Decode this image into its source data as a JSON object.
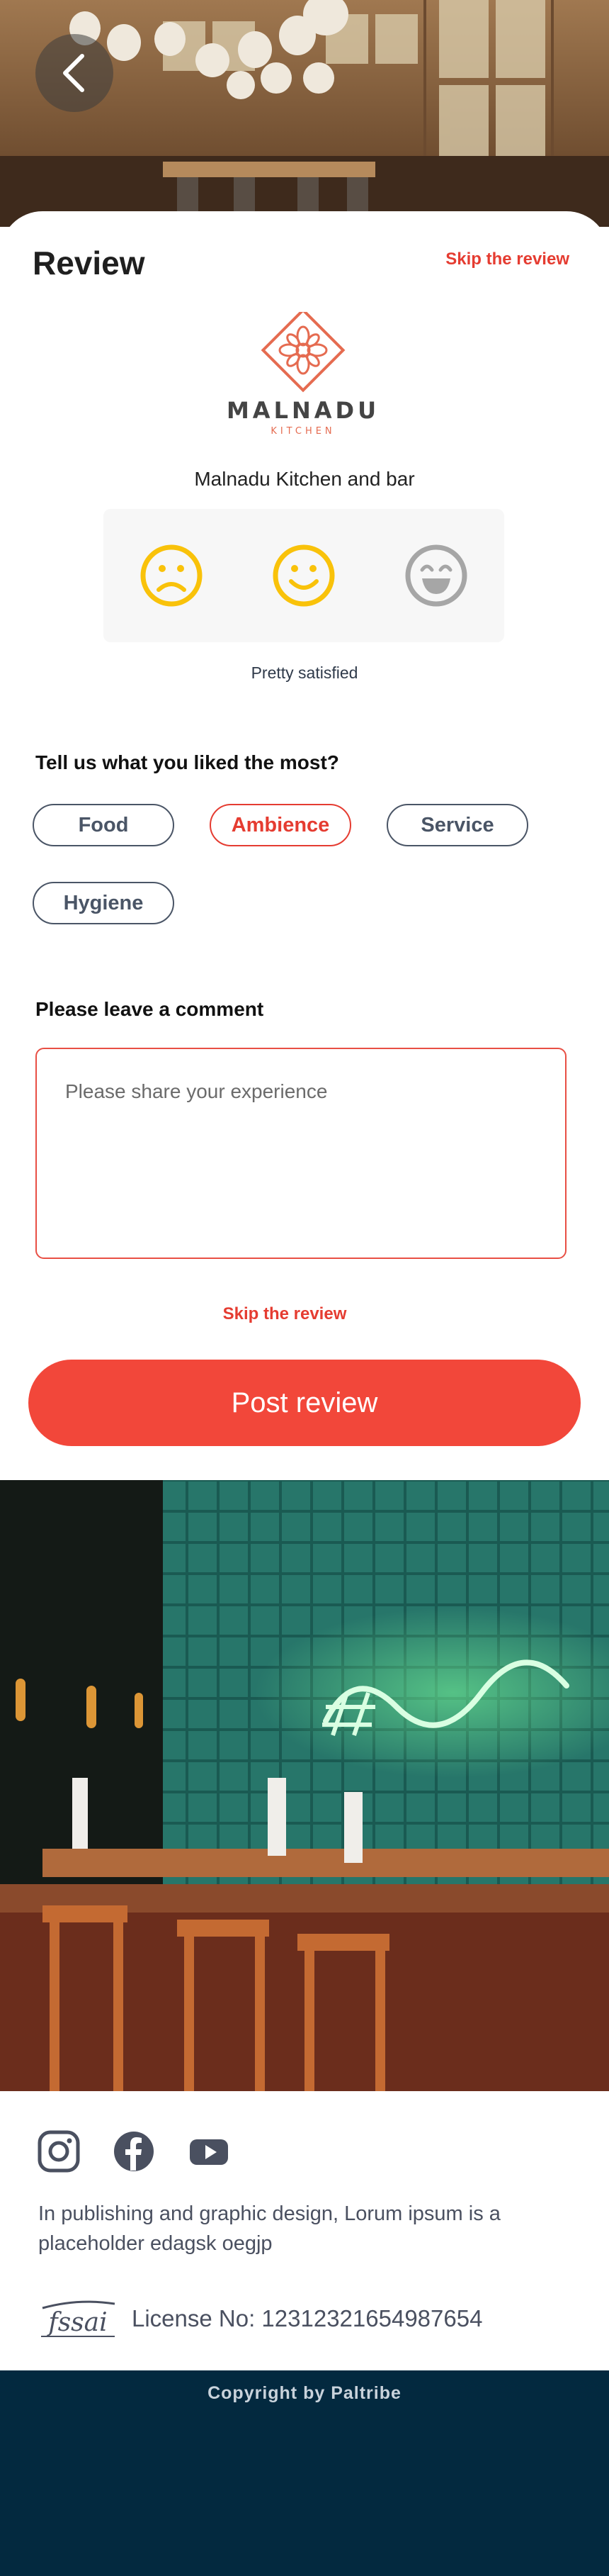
{
  "header": {
    "title": "Review",
    "skip_label": "Skip the review"
  },
  "restaurant": {
    "logo_text": "MALNADU",
    "logo_subtext": "KITCHEN",
    "name": "Malnadu Kitchen and bar"
  },
  "rating": {
    "options": [
      "frowning-face-icon",
      "smiling-face-icon",
      "grinning-face-icon"
    ],
    "selected_caption": "Pretty satisfied"
  },
  "likes": {
    "title": "Tell us what you liked the most?",
    "chips": [
      {
        "label": "Food",
        "selected": false
      },
      {
        "label": "Ambience",
        "selected": true
      },
      {
        "label": "Service",
        "selected": false
      },
      {
        "label": "Hygiene",
        "selected": false
      }
    ]
  },
  "comment": {
    "title": "Please leave a comment",
    "placeholder": "Please share your experience",
    "value": ""
  },
  "actions": {
    "skip_label": "Skip the review",
    "post_label": "Post review"
  },
  "footer": {
    "social": [
      "instagram-icon",
      "facebook-icon",
      "youtube-icon"
    ],
    "description": "In publishing and graphic design, Lorum ipsum is a placeholder edagsk oegjp",
    "fssai_text": "fssai",
    "license": "License No: 12312321654987654",
    "copyright": "Copyright by Paltribe"
  },
  "colors": {
    "accent": "#F2473A",
    "accent_text": "#E53C31",
    "emoji_yellow": "#F9C20A",
    "emoji_grey": "#A6A6A6",
    "footer_bar": "#03293F"
  }
}
